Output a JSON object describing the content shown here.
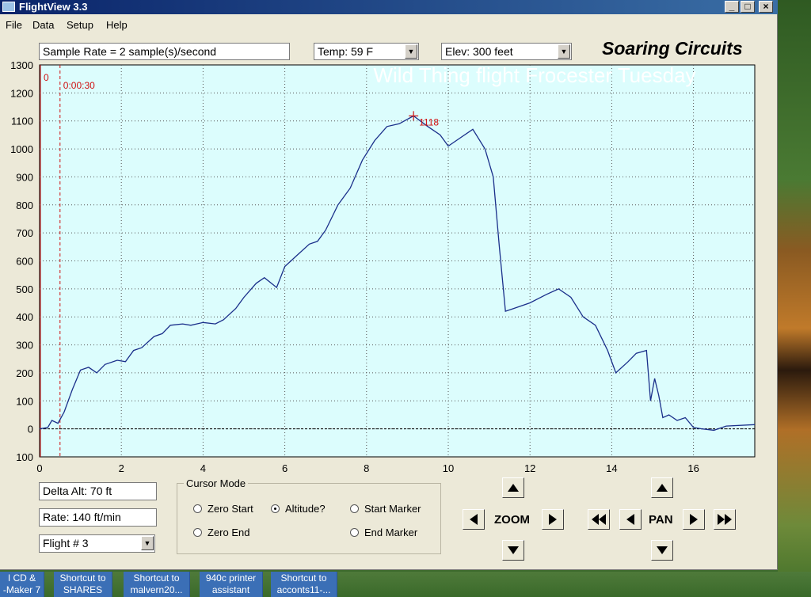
{
  "window": {
    "title": "FlightView 3.3",
    "controls": {
      "minimize": "_",
      "maximize": "□",
      "close": "×"
    }
  },
  "menu": [
    "File",
    "Data",
    "Setup",
    "Help"
  ],
  "toolbar": {
    "sample_rate": "Sample Rate =  2 sample(s)/second",
    "temp": "Temp:  59 F",
    "elev": "Elev:  300 feet",
    "brand": "Soaring Circuits"
  },
  "chart_data": {
    "type": "line",
    "title": "Wild Thing flight Frocester Tuesday",
    "xlim": [
      0,
      17.5
    ],
    "ylim": [
      -100,
      1300
    ],
    "x_ticks": [
      "0",
      "2",
      "4",
      "6",
      "8",
      "10",
      "12",
      "14",
      "16"
    ],
    "y_ticks": [
      "1300",
      "1200",
      "1100",
      "1000",
      "900",
      "800",
      "700",
      "600",
      "500",
      "400",
      "300",
      "200",
      "100",
      "0",
      "100"
    ],
    "marker_start_label": "0",
    "cursor_time_label": "0:00:30",
    "cursor_x": 0.5,
    "peak": {
      "x": 9.15,
      "y": 1118,
      "label": "1118"
    },
    "colors": {
      "plot_bg": "#dcfdfd",
      "line": "#1a2f8a",
      "marker": "#d01010"
    },
    "x": [
      0,
      0.2,
      0.3,
      0.45,
      0.6,
      0.8,
      1.0,
      1.2,
      1.4,
      1.6,
      1.9,
      2.1,
      2.3,
      2.5,
      2.8,
      3.0,
      3.2,
      3.5,
      3.7,
      4.0,
      4.3,
      4.5,
      4.8,
      5.0,
      5.3,
      5.5,
      5.8,
      6.0,
      6.3,
      6.6,
      6.8,
      7.0,
      7.3,
      7.6,
      7.9,
      8.2,
      8.5,
      8.8,
      9.15,
      9.5,
      9.8,
      10.0,
      10.3,
      10.6,
      10.9,
      11.1,
      11.25,
      11.4,
      11.6,
      12.0,
      12.4,
      12.7,
      13.0,
      13.3,
      13.6,
      13.9,
      14.1,
      14.4,
      14.6,
      14.85,
      14.95,
      15.05,
      15.15,
      15.25,
      15.4,
      15.6,
      15.8,
      16.0,
      16.2,
      16.5,
      16.8,
      17.5
    ],
    "y": [
      0,
      5,
      30,
      20,
      60,
      140,
      210,
      220,
      200,
      230,
      245,
      240,
      280,
      290,
      330,
      340,
      370,
      375,
      370,
      380,
      375,
      390,
      430,
      470,
      520,
      540,
      505,
      580,
      620,
      660,
      670,
      710,
      800,
      860,
      960,
      1030,
      1080,
      1090,
      1118,
      1080,
      1050,
      1010,
      1040,
      1070,
      1000,
      900,
      650,
      420,
      430,
      450,
      480,
      500,
      470,
      400,
      370,
      280,
      200,
      240,
      270,
      280,
      100,
      180,
      120,
      40,
      50,
      30,
      40,
      5,
      0,
      -5,
      10,
      15
    ]
  },
  "delta_alt": "Delta Alt: 70 ft",
  "rate": "Rate: 140 ft/min",
  "flight_select": "Flight # 3",
  "cursor_mode": {
    "legend": "Cursor Mode",
    "zero_start": "Zero Start",
    "altitude": "Altitude?",
    "start_marker": "Start Marker",
    "zero_end": "Zero End",
    "end_marker": "End Marker",
    "selected": "altitude"
  },
  "controls": {
    "zoom": "ZOOM",
    "pan": "PAN"
  },
  "taskbar": [
    [
      "I CD &",
      "-Maker 7"
    ],
    [
      "Shortcut to",
      "SHARES"
    ],
    [
      "Shortcut to",
      "malvern20..."
    ],
    [
      "940c printer",
      "assistant"
    ],
    [
      "Shortcut to",
      "acconts11-..."
    ]
  ]
}
